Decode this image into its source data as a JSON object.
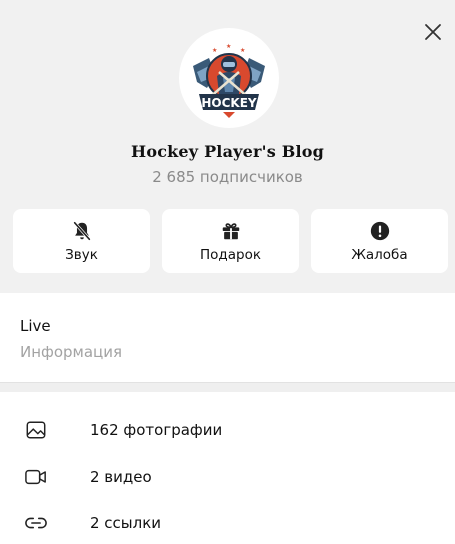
{
  "channel": {
    "name": "Hockey Player's Blog",
    "subscribers": "2 685 подписчиков",
    "logo_text": "HOCKEY"
  },
  "actions": [
    {
      "label": "Звук",
      "icon": "bell-off-icon"
    },
    {
      "label": "Подарок",
      "icon": "gift-icon"
    },
    {
      "label": "Жалоба",
      "icon": "alert-icon"
    }
  ],
  "info": {
    "title": "Live",
    "subtitle": "Информация"
  },
  "media": [
    {
      "label": "162 фотографии",
      "icon": "photo-icon"
    },
    {
      "label": "2 видео",
      "icon": "video-icon"
    },
    {
      "label": "2 ссылки",
      "icon": "link-icon"
    }
  ],
  "colors": {
    "header_bg": "#f1f1f1",
    "card_bg": "#ffffff",
    "muted_text": "#8a8a8a"
  }
}
